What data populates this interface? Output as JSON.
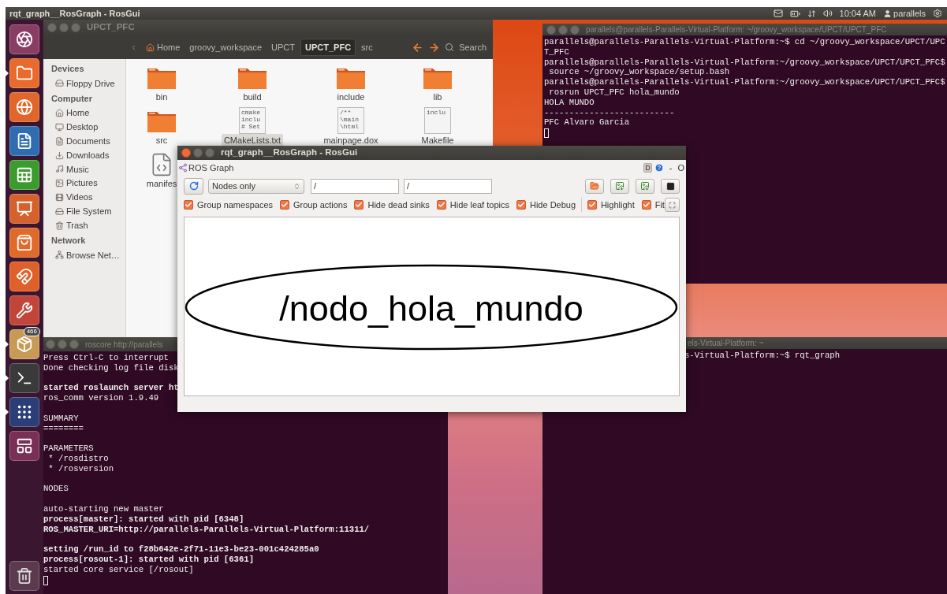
{
  "top_panel": {
    "title": "rqt_graph__RosGraph - RosGui",
    "clock": "10:04 AM",
    "user": "parallels"
  },
  "launcher": {
    "items": [
      {
        "kind": "dash",
        "running": false
      },
      {
        "kind": "files",
        "running": true
      },
      {
        "kind": "browser",
        "running": false
      },
      {
        "kind": "writer",
        "running": false
      },
      {
        "kind": "calc",
        "running": false
      },
      {
        "kind": "impress",
        "running": false
      },
      {
        "kind": "store",
        "running": false
      },
      {
        "kind": "cloud",
        "running": false
      },
      {
        "kind": "settings",
        "running": false
      },
      {
        "kind": "updates",
        "running": true,
        "badge": "466"
      },
      {
        "kind": "terminal",
        "running": true
      },
      {
        "kind": "workspaces",
        "running": true
      },
      {
        "kind": "windows",
        "running": false
      }
    ]
  },
  "file_manager": {
    "active": false,
    "title": "UPCT_PFC",
    "path": [
      {
        "label": "Home",
        "selected": false
      },
      {
        "label": "groovy_workspace",
        "selected": false
      },
      {
        "label": "UPCT",
        "selected": false
      },
      {
        "label": "UPCT_PFC",
        "selected": true
      },
      {
        "label": "src",
        "selected": false
      }
    ],
    "search": "Search",
    "sidebar": [
      {
        "heading": "Devices",
        "items": [
          {
            "label": "Floppy Drive",
            "kind": "drive"
          }
        ]
      },
      {
        "heading": "Computer",
        "items": [
          {
            "label": "Home",
            "kind": "home"
          },
          {
            "label": "Desktop",
            "kind": "desktop"
          },
          {
            "label": "Documents",
            "kind": "documents"
          },
          {
            "label": "Downloads",
            "kind": "downloads"
          },
          {
            "label": "Music",
            "kind": "music"
          },
          {
            "label": "Pictures",
            "kind": "pictures"
          },
          {
            "label": "Videos",
            "kind": "videos"
          },
          {
            "label": "File System",
            "kind": "filesystem"
          },
          {
            "label": "Trash",
            "kind": "trash"
          }
        ]
      },
      {
        "heading": "Network",
        "items": [
          {
            "label": "Browse Net…",
            "kind": "network"
          }
        ]
      }
    ],
    "files": [
      {
        "name": "bin",
        "kind": "folder",
        "selected": false
      },
      {
        "name": "build",
        "kind": "folder",
        "selected": false
      },
      {
        "name": "include",
        "kind": "folder",
        "selected": false
      },
      {
        "name": "lib",
        "kind": "folder",
        "selected": false
      },
      {
        "name": "src",
        "kind": "folder",
        "selected": false
      },
      {
        "name": "CMakeLists.txt",
        "kind": "text",
        "selected": true,
        "preview": [
          "cmake",
          "inclu",
          "# Set"
        ]
      },
      {
        "name": "mainpage.dox",
        "kind": "text",
        "selected": false,
        "preview": [
          "/**",
          "\\main",
          "\\html"
        ]
      },
      {
        "name": "Makefile",
        "kind": "text",
        "selected": false,
        "preview": [
          "inclu"
        ]
      },
      {
        "name": "manifes",
        "kind": "xml",
        "selected": false
      }
    ]
  },
  "terminals": [
    {
      "active": false,
      "title": "parallels@parallels-Parallels-Virtual-Platform: ~/groovy_workspace/UPCT/UPCT_PFC",
      "cursor": true,
      "blocks": [
        [
          {
            "text": "parallels@parallels-Parallels-Virtual-Platform:~$ cd ~/groovy_workspace/UPCT/UPC",
            "bold": false
          },
          {
            "text": "T_PFC",
            "bold": false
          },
          {
            "text": "parallels@parallels-Parallels-Virtual-Platform:~/groovy_workspace/UPCT/UPCT_PFC$",
            "bold": false
          },
          {
            "text": " source ~/groovy_workspace/setup.bash",
            "bold": false
          },
          {
            "text": "parallels@parallels-Parallels-Virtual-Platform:~/groovy_workspace/UPCT/UPCT_PFC$",
            "bold": false
          },
          {
            "text": " rosrun UPCT_PFC hola_mundo",
            "bold": false
          },
          {
            "text": "HOLA MUNDO",
            "bold": false
          },
          {
            "text": "--------------------------",
            "bold": false
          },
          {
            "text": "PFC Alvaro Garcia",
            "bold": false
          }
        ]
      ]
    },
    {
      "active": false,
      "title": "roscore http://parallels",
      "cursor": true,
      "blocks": [
        [
          {
            "text": "Press Ctrl-C to interrupt",
            "bold": false
          },
          {
            "text": "Done checking log file disk",
            "bold": false
          }
        ],
        [
          {
            "text": "started roslaunch server ht",
            "bold": true
          },
          {
            "text": "ros_comm version 1.9.49",
            "bold": false
          }
        ],
        [
          {
            "text": "SUMMARY",
            "bold": false
          },
          {
            "text": "========",
            "bold": false
          }
        ],
        [
          {
            "text": "PARAMETERS",
            "bold": false
          },
          {
            "text": " * /rosdistro",
            "bold": false
          },
          {
            "text": " * /rosversion",
            "bold": false
          }
        ],
        [
          {
            "text": "NODES",
            "bold": false
          }
        ],
        [
          {
            "text": "auto-starting new master",
            "bold": false
          },
          {
            "text": "process[master]: started with pid [6348]",
            "bold": true
          },
          {
            "text": "ROS_MASTER_URI=http://parallels-Parallels-Virtual-Platform:11311/",
            "bold": true
          }
        ],
        [
          {
            "text": "setting /run_id to f28b642e-2f71-11e3-be23-001c424285a0",
            "bold": true
          },
          {
            "text": "process[rosout-1]: started with pid [6361]",
            "bold": true
          },
          {
            "text": "started core service [/rosout]",
            "bold": false
          }
        ]
      ]
    },
    {
      "active": false,
      "title": "els-Virtual-Platform: ~",
      "cursor": false,
      "blocks": [
        [
          {
            "text": "s-Virtual-Platform:~$ rqt_graph",
            "bold": false
          }
        ]
      ]
    }
  ],
  "rqt": {
    "active": true,
    "title": "rqt_graph__RosGraph - RosGui",
    "plugin": "ROS Graph",
    "plugin_controls": [
      {
        "kind": "badge",
        "label": "D"
      },
      {
        "kind": "help"
      },
      {
        "kind": "text",
        "label": "-"
      },
      {
        "kind": "text",
        "label": "O"
      }
    ],
    "mode": "Nodes only",
    "filters": [
      {
        "value": "/"
      },
      {
        "value": "/"
      }
    ],
    "options": [
      {
        "label": "Group namespaces",
        "checked": true
      },
      {
        "label": "Group actions",
        "checked": true
      },
      {
        "label": "Hide dead sinks",
        "checked": true
      },
      {
        "label": "Hide leaf topics",
        "checked": true
      },
      {
        "label": "Hide Debug",
        "checked": true
      }
    ],
    "view_options": [
      {
        "label": "Highlight",
        "checked": true
      },
      {
        "label": "Fit",
        "checked": true
      }
    ],
    "nodes": [
      {
        "label": "/nodo_hola_mundo"
      }
    ]
  }
}
